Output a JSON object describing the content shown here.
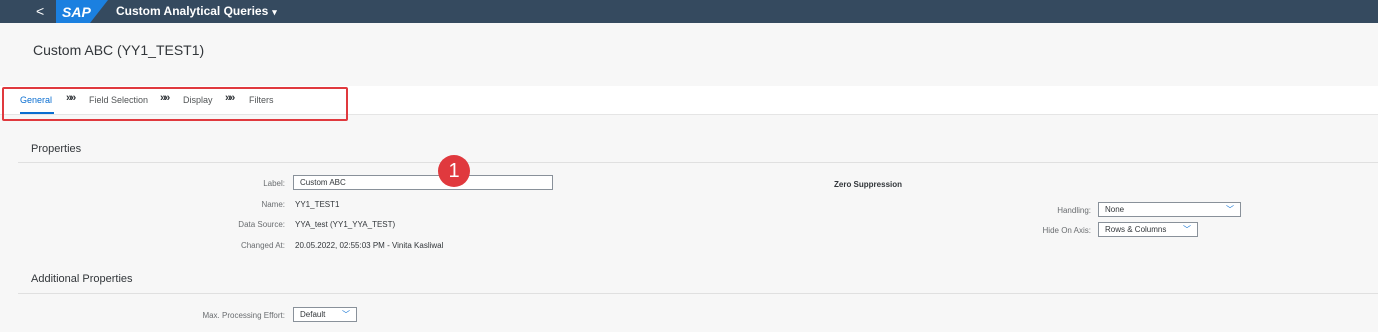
{
  "shell": {
    "back_glyph": "<",
    "logo_text": "SAP",
    "app_title": "Custom Analytical Queries",
    "app_title_caret": "▾"
  },
  "header": {
    "title": "Custom ABC (YY1_TEST1)"
  },
  "nav": {
    "steps": [
      "General",
      "Field Selection",
      "Display",
      "Filters"
    ],
    "separator": "»»",
    "active_index": 0
  },
  "annotation": {
    "badge_number": "1",
    "highlight_color": "#e0393e"
  },
  "properties": {
    "section_title": "Properties",
    "label_label": "Label:",
    "label_value": "Custom ABC",
    "name_label": "Name:",
    "name_value": "YY1_TEST1",
    "datasource_label": "Data Source:",
    "datasource_value": "YYA_test (YY1_YYA_TEST)",
    "changed_label": "Changed At:",
    "changed_value": "20.05.2022, 02:55:03 PM - Vinita Kasliwal",
    "zero_suppression_title": "Zero Suppression",
    "handling_label": "Handling:",
    "handling_value": "None",
    "hide_axis_label": "Hide On Axis:",
    "hide_axis_value": "Rows & Columns"
  },
  "additional": {
    "section_title": "Additional Properties",
    "max_effort_label": "Max. Processing Effort:",
    "max_effort_value": "Default"
  },
  "colors": {
    "shell_bg": "#354a5f",
    "accent": "#0a6ed1",
    "logo_blue": "#1b80e0"
  }
}
